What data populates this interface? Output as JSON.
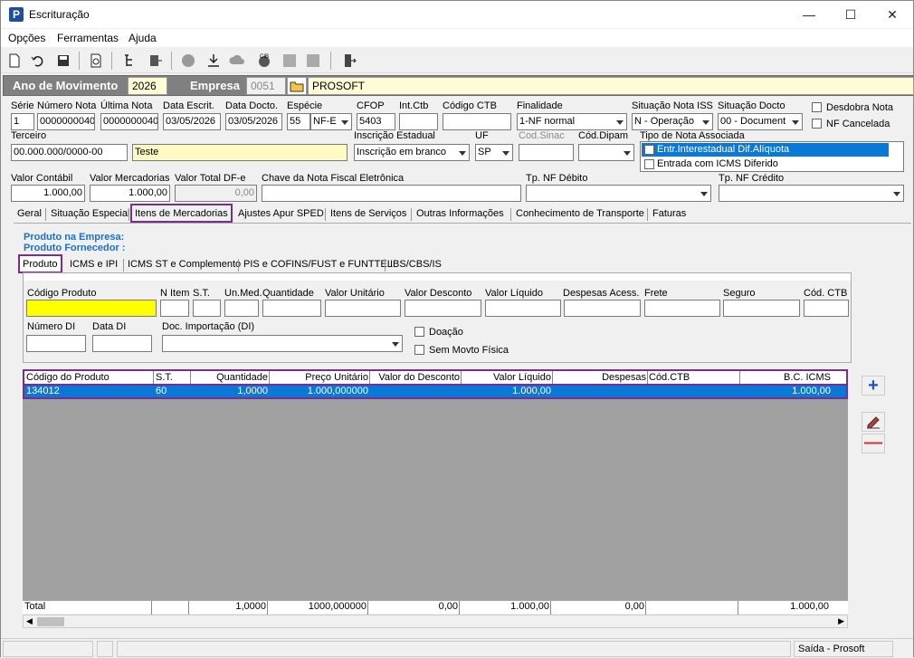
{
  "window": {
    "title": "Escrituração"
  },
  "menu": [
    "Opções",
    "Ferramentas",
    "Ajuda"
  ],
  "header": {
    "ano_label": "Ano de Movimento",
    "ano_value": "2026",
    "empresa_label": "Empresa",
    "empresa_code": "0051",
    "empresa_name": "PROSOFT"
  },
  "row1": {
    "serie": {
      "label": "Série",
      "value": "1"
    },
    "numero_nota": {
      "label": "Número Nota",
      "value": "0000000040"
    },
    "ultima_nota": {
      "label": "Última Nota",
      "value": "0000000040"
    },
    "data_escrit": {
      "label": "Data Escrit.",
      "value": "03/05/2026"
    },
    "data_docto": {
      "label": "Data Docto.",
      "value": "03/05/2026"
    },
    "especie": {
      "label": "Espécie",
      "value": "55",
      "value2": "NF-E"
    },
    "cfop": {
      "label": "CFOP",
      "value": "5403"
    },
    "int_ctb": {
      "label": "Int.Ctb",
      "value": ""
    },
    "codigo_ctb": {
      "label": "Código CTB",
      "value": ""
    },
    "finalidade": {
      "label": "Finalidade",
      "value": "1-NF normal"
    },
    "situacao_iss": {
      "label": "Situação Nota ISS",
      "value": "N - Operação"
    },
    "situacao_docto": {
      "label": "Situação Docto",
      "value": "00 - Document"
    },
    "desdobra_nota": "Desdobra Nota",
    "nf_cancelada": "NF Cancelada"
  },
  "row2": {
    "terceiro": {
      "label": "Terceiro",
      "code": "00.000.000/0000-00",
      "name": "Teste"
    },
    "inscricao": {
      "label": "Inscrição Estadual",
      "value": "Inscrição em branco"
    },
    "uf": {
      "label": "UF",
      "value": "SP"
    },
    "cod_sinac": {
      "label": "Cod.Sinac",
      "value": ""
    },
    "cod_dipam": {
      "label": "Cód.Dipam",
      "value": ""
    },
    "tipo_nota": {
      "label": "Tipo de Nota Associada",
      "items": [
        "Entr.Interestadual Dif.Alíquota",
        "Entrada com ICMS Diferido"
      ]
    }
  },
  "row3": {
    "valor_contabil": {
      "label": "Valor Contábil",
      "value": "1.000,00"
    },
    "valor_mercadorias": {
      "label": "Valor Mercadorias",
      "value": "1.000,00"
    },
    "valor_total_dfe": {
      "label": "Valor Total DF-e",
      "value": "0,00"
    },
    "chave": {
      "label": "Chave da Nota Fiscal Eletrônica",
      "value": ""
    },
    "tp_debito": {
      "label": "Tp. NF Débito",
      "value": ""
    },
    "tp_credito": {
      "label": "Tp. NF Crédito",
      "value": ""
    }
  },
  "main_tabs": [
    "Geral",
    "Situação Especial",
    "Itens de Mercadorias",
    "Ajustes Apur SPED",
    "Itens de Serviços",
    "Outras Informações",
    "Conhecimento de Transporte",
    "Faturas"
  ],
  "produto_empresa": "Produto na Empresa:",
  "produto_fornecedor": "Produto Fornecedor :",
  "sub_tabs": [
    "Produto",
    "ICMS e IPI",
    "ICMS ST e Complemento",
    "PIS e COFINS/FUST e FUNTTEL",
    "IBS/CBS/IS"
  ],
  "prod_labels": {
    "codigo_produto": "Código Produto",
    "n_item": "N Item",
    "st": "S.T.",
    "un_med": "Un.Med.",
    "quantidade": "Quantidade",
    "valor_unitario": "Valor Unitário",
    "valor_desconto": "Valor Desconto",
    "valor_liquido": "Valor Líquido",
    "despesas": "Despesas Acess.",
    "frete": "Frete",
    "seguro": "Seguro",
    "cod_ctb": "Cód. CTB",
    "numero_di": "Número DI",
    "data_di": "Data DI",
    "doc_importacao": "Doc. Importação (DI)",
    "doacao": "Doação",
    "sem_movto": "Sem Movto Física"
  },
  "grid": {
    "headers": [
      "Código do Produto",
      "S.T.",
      "Quantidade",
      "Preço Unitário",
      "Valor do Desconto",
      "Valor Líquido",
      "Despesas",
      "Cód.CTB",
      "B.C. ICMS"
    ],
    "row": [
      "134012",
      "60",
      "1,0000",
      "1.000,000000",
      "",
      "1.000,00",
      "",
      "",
      "1.000,00"
    ],
    "totals": [
      "Total",
      "",
      "1,0000",
      "1000,000000",
      "0,00",
      "1.000,00",
      "0,00",
      "",
      "1.000,00"
    ]
  },
  "status": {
    "right": "Saída - Prosoft"
  },
  "colors": {
    "accent": "#7b2d8e",
    "selection": "#0a78d7",
    "header_bg": "#808080",
    "field_yellow": "#fff9c4"
  }
}
